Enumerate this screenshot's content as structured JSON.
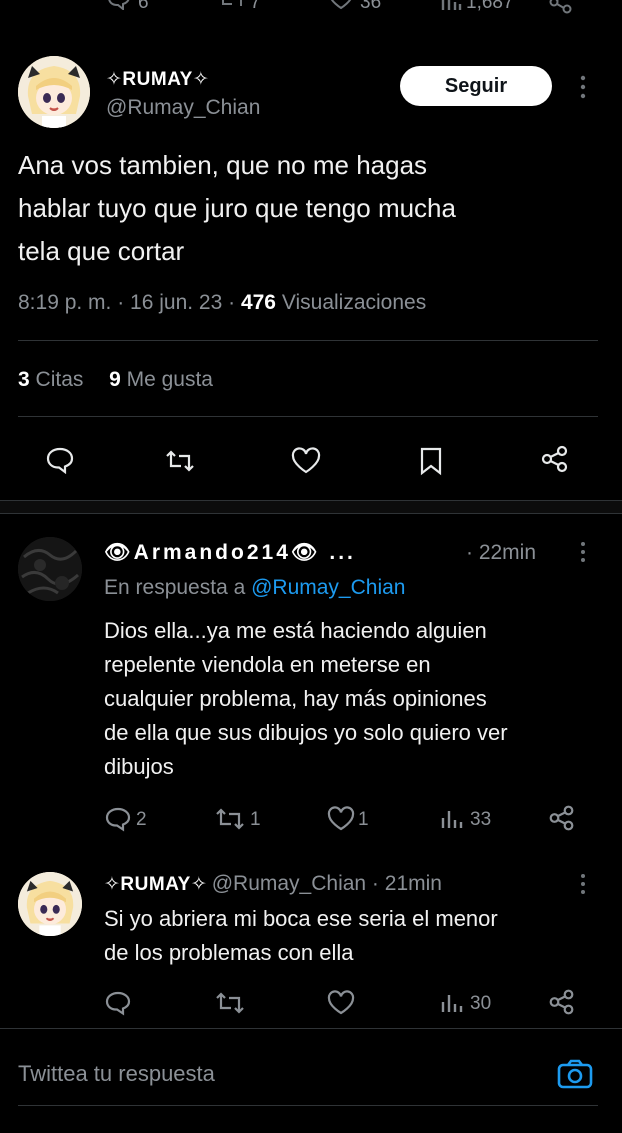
{
  "top_bar": {
    "reply_count": "6",
    "retweet_count": "7",
    "like_count": "36",
    "view_count": "1,687"
  },
  "main_tweet": {
    "display_name": "✧RUMAY✧",
    "handle": "@Rumay_Chian",
    "follow_label": "Seguir",
    "text_lines": [
      "Ana vos tambien, que no me hagas",
      "hablar tuyo que juro que tengo mucha",
      "tela que cortar"
    ],
    "time": "8:19 p. m. · 16 jun. 23 · ",
    "views_count": "476",
    "views_label": "Visualizaciones",
    "quotes_count": "3",
    "quotes_label": "Citas",
    "likes_count": "9",
    "likes_label": "Me gusta"
  },
  "reply_1": {
    "display_name": "👁Armando214👁 ...",
    "time": "· 22min",
    "in_reply_prefix": "En respuesta a ",
    "in_reply_handle": "@Rumay_Chian",
    "text_lines": [
      "Dios ella...ya me está haciendo alguien",
      "repelente viendola en meterse en",
      "cualquier problema, hay más opiniones",
      "de ella que sus dibujos yo solo quiero ver",
      "dibujos"
    ],
    "reply_count": "2",
    "retweet_count": "1",
    "like_count": "1",
    "view_count": "33"
  },
  "reply_2": {
    "display_name": "✧RUMAY✧",
    "meta": "@Rumay_Chian · 21min",
    "text_lines": [
      "Si yo abriera mi boca ese seria el menor",
      "de los problemas con ella"
    ],
    "view_count": "30"
  },
  "compose": {
    "placeholder": "Twittea tu respuesta"
  },
  "icons": {
    "reply": "speech-bubble-icon",
    "retweet": "retweet-icon",
    "like": "heart-icon",
    "bookmark": "bookmark-icon",
    "share": "share-icon",
    "views": "bar-chart-icon",
    "more": "more-vertical-icon",
    "camera": "camera-icon"
  },
  "colors": {
    "background": "#000000",
    "text": "#e7e9ea",
    "muted": "#71767b",
    "accent": "#1d9bf0"
  }
}
